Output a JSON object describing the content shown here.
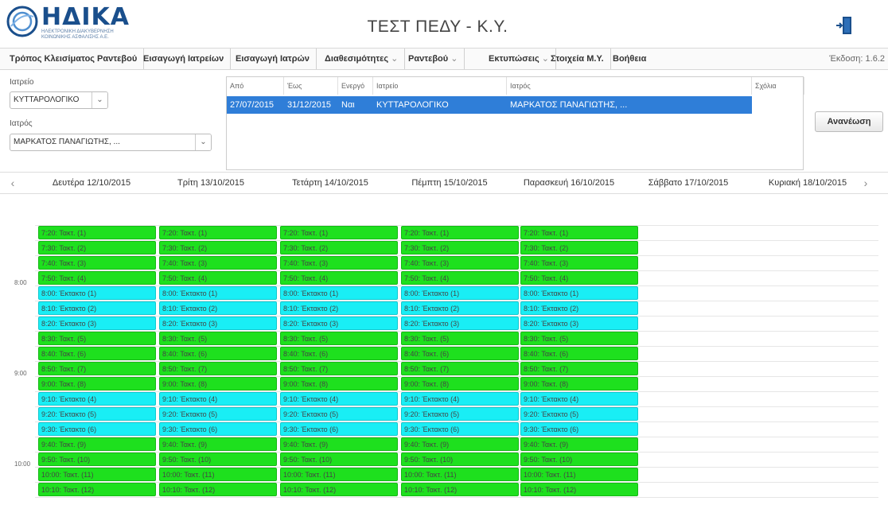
{
  "header": {
    "brand": "ΗΔΙΚΑ",
    "brand_sub": "ΗΛΕΚΤΡΟΝΙΚΗ ΔΙΑΚΥΒΕΡΝΗΣΗ ΚΟΙΝΩΝΙΚΗΣ ΑΣΦΑΛΙΣΗΣ Α.Ε.",
    "title": "ΤΕΣΤ ΠΕΔΥ - Κ.Υ.",
    "logout_icon": "exit-door-icon"
  },
  "menu": {
    "items": [
      {
        "label": "Τρόπος Κλεισίματος Ραντεβού",
        "dropdown": false
      },
      {
        "label": "Εισαγωγή Ιατρείων",
        "dropdown": false
      },
      {
        "label": "Εισαγωγή Ιατρών",
        "dropdown": false
      },
      {
        "label": "Διαθεσιμότητες",
        "dropdown": true
      },
      {
        "label": "Ραντεβού",
        "dropdown": true
      },
      {
        "label": "Εκτυπώσεις",
        "dropdown": true
      },
      {
        "label": "Στοιχεία Μ.Υ.",
        "dropdown": false
      },
      {
        "label": "Βοήθεια",
        "dropdown": false
      }
    ],
    "version": "Έκδοση: 1.6.2"
  },
  "filters": {
    "clinic_label": "Ιατρείο",
    "clinic_value": "ΚΥΤΤΑΡΟΛΟΓΙΚΟ",
    "doctor_label": "Ιατρός",
    "doctor_value": "ΜΑΡΚΑΤΟΣ ΠΑΝΑΓΙΩΤΗΣ, ..."
  },
  "schedule": {
    "columns": [
      "Από",
      "Έως",
      "Ενεργό",
      "Ιατρείο",
      "Ιατρός",
      "Σχόλια"
    ],
    "rows": [
      {
        "from": "27/07/2015",
        "to": "31/12/2015",
        "active": "Ναι",
        "clinic": "ΚΥΤΤΑΡΟΛΟΓΙΚΟ",
        "doctor": "ΜΑΡΚΑΤΟΣ ΠΑΝΑΓΙΩΤΗΣ, ...",
        "comments": ""
      }
    ],
    "refresh_label": "Ανανέωση"
  },
  "calendar": {
    "prev_icon": "chevron-left-icon",
    "next_icon": "chevron-right-icon",
    "days": [
      "Δευτέρα 12/10/2015",
      "Τρίτη 13/10/2015",
      "Τετάρτη 14/10/2015",
      "Πέμπτη 15/10/2015",
      "Παρασκευή 16/10/2015",
      "Σάββατο 17/10/2015",
      "Κυριακή 18/10/2015"
    ],
    "hour_labels": [
      "8:00",
      "9:00",
      "10:00"
    ],
    "active_day_count": 5,
    "colors": {
      "regular": "#1ee01e",
      "extra": "#19eef5"
    },
    "slots": [
      {
        "label": "7:20: Τακτ. (1)",
        "type": "regular"
      },
      {
        "label": "7:30: Τακτ. (2)",
        "type": "regular"
      },
      {
        "label": "7:40: Τακτ. (3)",
        "type": "regular"
      },
      {
        "label": "7:50: Τακτ. (4)",
        "type": "regular"
      },
      {
        "label": "8:00: Έκτακτο (1)",
        "type": "extra"
      },
      {
        "label": "8:10: Έκτακτο (2)",
        "type": "extra"
      },
      {
        "label": "8:20: Έκτακτο (3)",
        "type": "extra"
      },
      {
        "label": "8:30: Τακτ. (5)",
        "type": "regular"
      },
      {
        "label": "8:40: Τακτ. (6)",
        "type": "regular"
      },
      {
        "label": "8:50: Τακτ. (7)",
        "type": "regular"
      },
      {
        "label": "9:00: Τακτ. (8)",
        "type": "regular"
      },
      {
        "label": "9:10: Έκτακτο (4)",
        "type": "extra"
      },
      {
        "label": "9:20: Έκτακτο (5)",
        "type": "extra"
      },
      {
        "label": "9:30: Έκτακτο (6)",
        "type": "extra"
      },
      {
        "label": "9:40: Τακτ. (9)",
        "type": "regular"
      },
      {
        "label": "9:50: Τακτ. (10)",
        "type": "regular"
      },
      {
        "label": "10:00: Τακτ. (11)",
        "type": "regular"
      },
      {
        "label": "10:10: Τακτ. (12)",
        "type": "regular"
      }
    ]
  }
}
